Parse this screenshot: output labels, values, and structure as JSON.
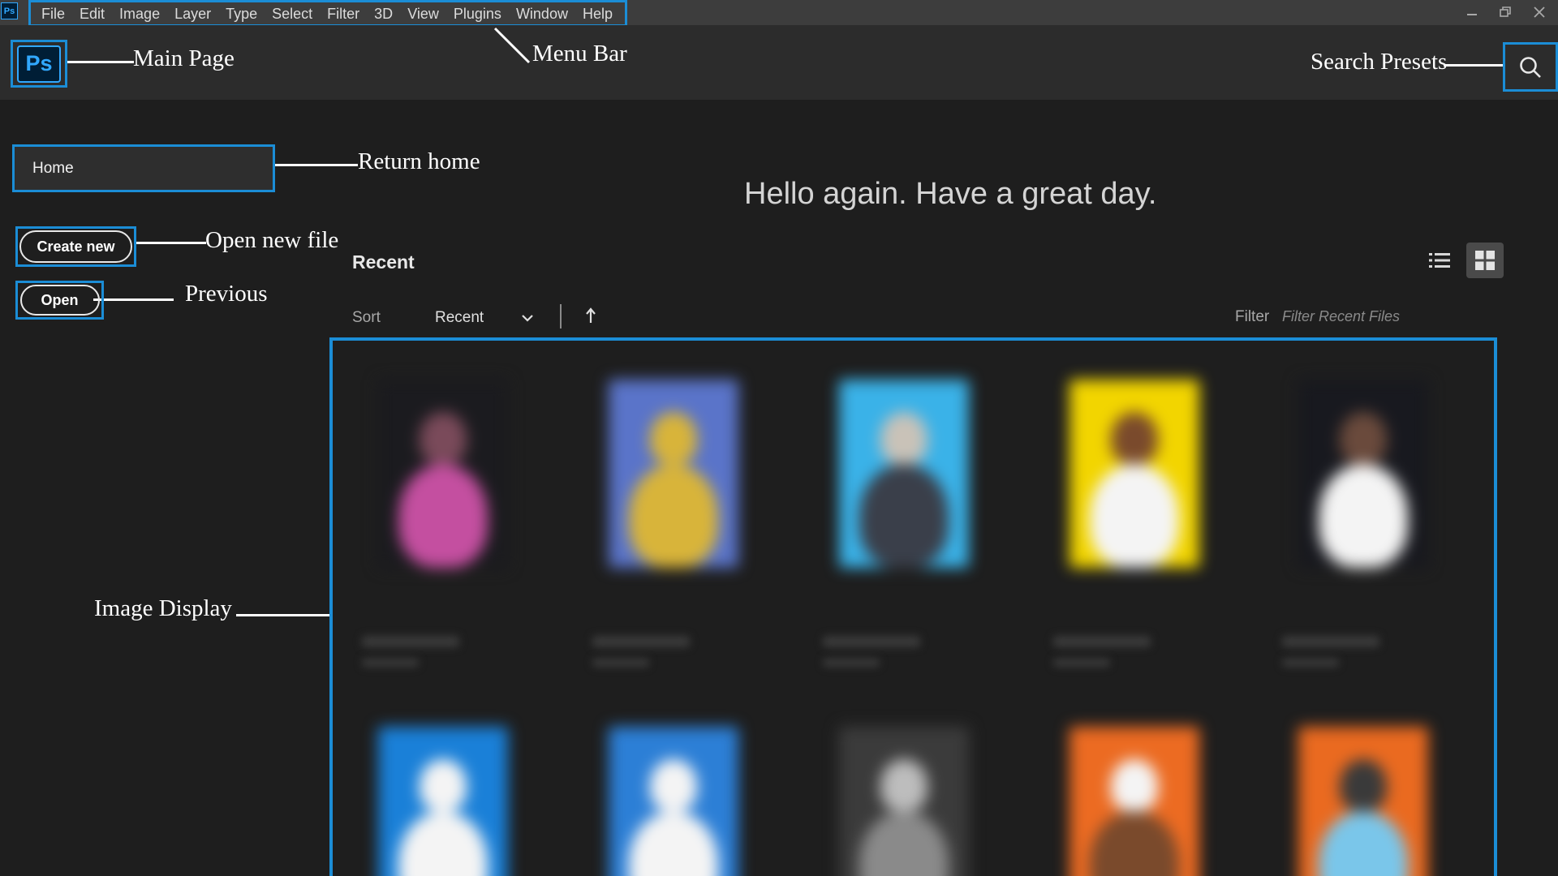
{
  "titlebar": {
    "app_icon": "Ps",
    "menu": [
      "File",
      "Edit",
      "Image",
      "Layer",
      "Type",
      "Select",
      "Filter",
      "3D",
      "View",
      "Plugins",
      "Window",
      "Help"
    ],
    "window_controls": [
      "minimize-icon",
      "restore-icon",
      "close-icon"
    ]
  },
  "header": {
    "logo_text": "Ps",
    "search_icon": "search-icon"
  },
  "annotations": {
    "main_page": "Main Page",
    "menu_bar": "Menu Bar",
    "search_presets": "Search Presets",
    "return_home": "Return home",
    "open_new_file": "Open new file",
    "previous": "Previous",
    "image_display": "Image Display"
  },
  "sidebar": {
    "home_label": "Home",
    "create_new_label": "Create new",
    "open_label": "Open"
  },
  "main": {
    "greeting": "Hello again. Have a great day.",
    "recent_heading": "Recent",
    "sort_label": "Sort",
    "sort_value": "Recent",
    "filter_label": "Filter",
    "filter_placeholder": "Filter Recent Files",
    "view_icons": [
      "list-view-icon",
      "grid-view-icon"
    ]
  },
  "thumbnails": [
    {
      "bg": "#1b1b1f",
      "figure": "#7a4a5a",
      "accent": "#c44fa0"
    },
    {
      "bg": "#5a74c9",
      "figure": "#d8b43a",
      "accent": "#d8b43a"
    },
    {
      "bg": "#3ab2e8",
      "figure": "#c9c2b8",
      "accent": "#3a3f4a"
    },
    {
      "bg": "#f2d500",
      "figure": "#7a4a2c",
      "accent": "#f4f4f4"
    },
    {
      "bg": "#18191f",
      "figure": "#6a4a3c",
      "accent": "#f4f4f4"
    },
    {
      "bg": "#1a80d8",
      "figure": "#f4f4f4",
      "accent": "#f4f4f4"
    },
    {
      "bg": "#2c7fd6",
      "figure": "#f4f4f4",
      "accent": "#f4f4f4"
    },
    {
      "bg": "#3b3b3b",
      "figure": "#bdbdbd",
      "accent": "#8a8a8a"
    },
    {
      "bg": "#ec6b22",
      "figure": "#f4f4f4",
      "accent": "#7a4a2c"
    },
    {
      "bg": "#ea6a20",
      "figure": "#3a3a3a",
      "accent": "#7ac6ea"
    }
  ]
}
